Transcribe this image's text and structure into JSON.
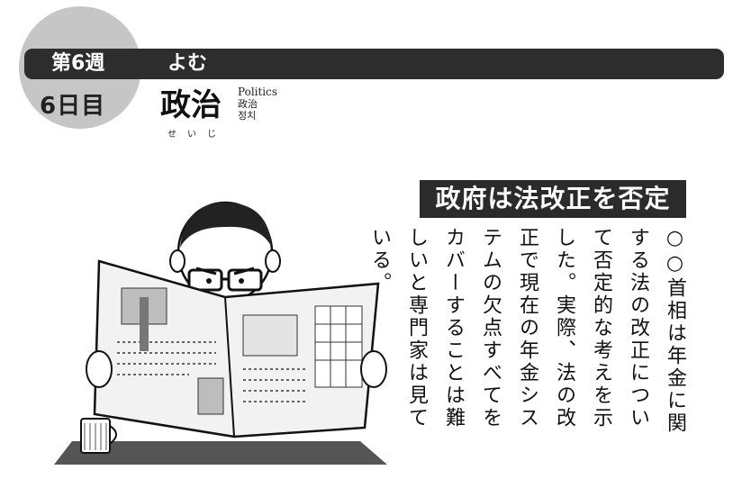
{
  "header": {
    "week_label": "第6週",
    "activity": "よむ",
    "day_label": "6日目"
  },
  "topic": {
    "title": "政治",
    "reading": "せいじ",
    "translation_en": "Politics",
    "translation_zh": "政治",
    "translation_ko": "정치"
  },
  "article": {
    "headline": "政府は法改正を否定",
    "body": "○○首相は年金に関する法の改正について否定的な考えを示した。実際、法の改正で現在の年金システムの欠点すべてをカバーすることは難しいと専門家は見ている。"
  },
  "illustration": {
    "description_icon": "man-reading-newspaper-icon"
  }
}
